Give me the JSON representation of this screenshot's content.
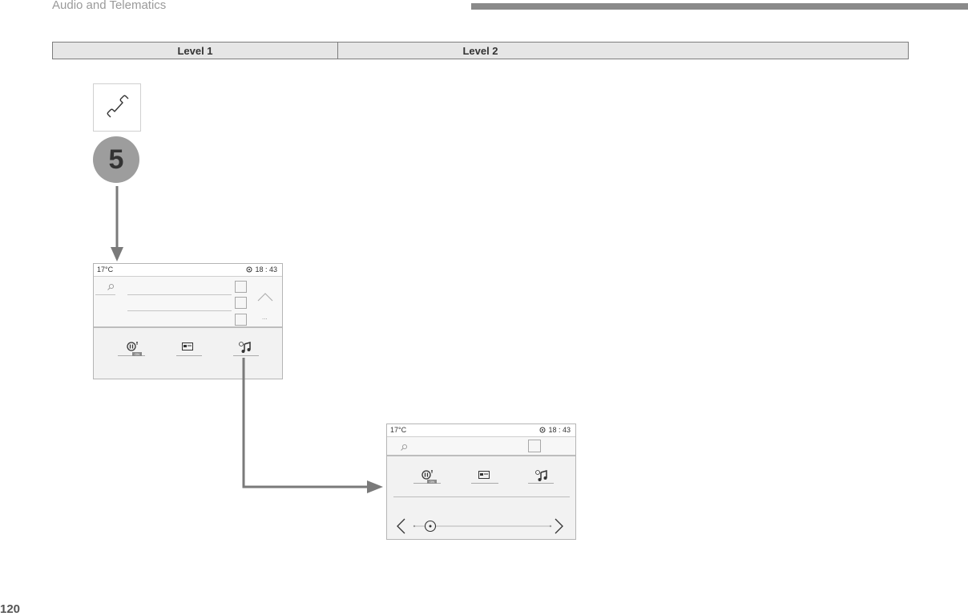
{
  "header": {
    "title": "Audio and Telematics"
  },
  "levels": {
    "level1": "Level 1",
    "level2": "Level 2"
  },
  "step": {
    "number": "5"
  },
  "screen1": {
    "temperature": "17°C",
    "time": "18 : 43",
    "dots": "...",
    "on_badge": "ON"
  },
  "screen2": {
    "temperature": "17°C",
    "time": "18 : 43",
    "on_badge": "ON"
  },
  "page_number": "120",
  "colors": {
    "accent_gray": "#8a8a8a",
    "badge_gray": "#9d9d9d",
    "arrow_gray": "#7a7a7a"
  }
}
